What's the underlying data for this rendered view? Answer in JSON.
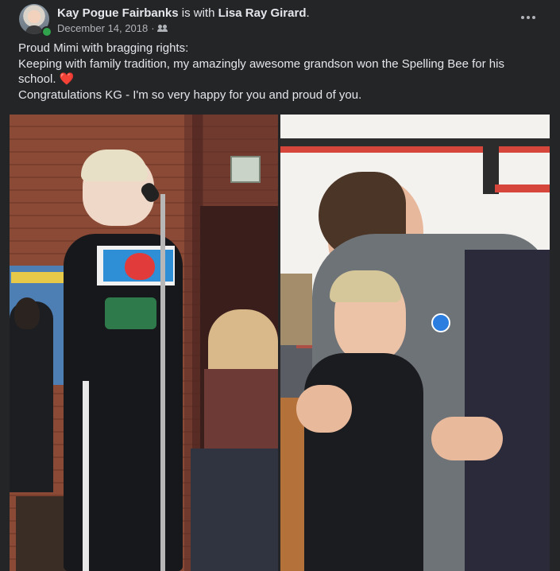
{
  "post": {
    "author": "Kay Pogue Fairbanks",
    "with_text": "is with",
    "tagged": "Lisa Ray Girard",
    "tagged_suffix": ".",
    "date": "December 14, 2018",
    "separator": "·",
    "audience_icon": "friends-icon",
    "more_icon": "more-options-icon",
    "lines": [
      "Proud Mimi with bragging rights:",
      "Keeping with family tradition, my amazingly awesome grandson won the Spelling Bee for his school.",
      "Congratulations KG - I'm so very happy for you and proud of you."
    ],
    "heart_emoji": "❤️"
  },
  "colors": {
    "background": "#242526",
    "text_primary": "#e4e6eb",
    "text_secondary": "#b0b3b8",
    "online": "#31a24c",
    "heart": "#e0245e"
  }
}
